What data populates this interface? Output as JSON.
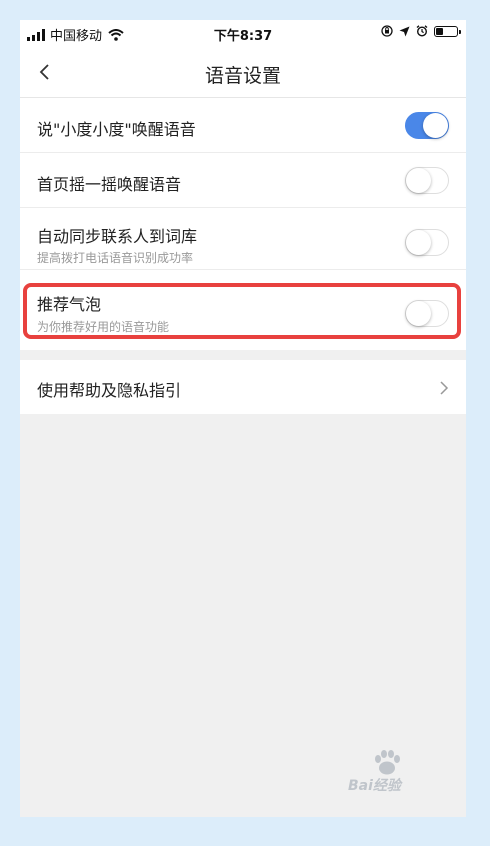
{
  "status_bar": {
    "carrier": "中国移动",
    "time": "下午8:37"
  },
  "nav": {
    "title": "语音设置"
  },
  "settings": [
    {
      "label": "说\"小度小度\"唤醒语音",
      "sublabel": "",
      "toggle_on": true
    },
    {
      "label": "首页摇一摇唤醒语音",
      "sublabel": "",
      "toggle_on": false
    },
    {
      "label": "自动同步联系人到词库",
      "sublabel": "提高拨打电话语音识别成功率",
      "toggle_on": false
    },
    {
      "label": "推荐气泡",
      "sublabel": "为你推荐好用的语音功能",
      "toggle_on": false
    }
  ],
  "help_row": {
    "label": "使用帮助及隐私指引"
  },
  "watermark": {
    "text": "Bai经验"
  },
  "colors": {
    "toggle_on": "#4a87e8",
    "highlight": "#e8413e",
    "page_bg": "#f0f0f0"
  }
}
